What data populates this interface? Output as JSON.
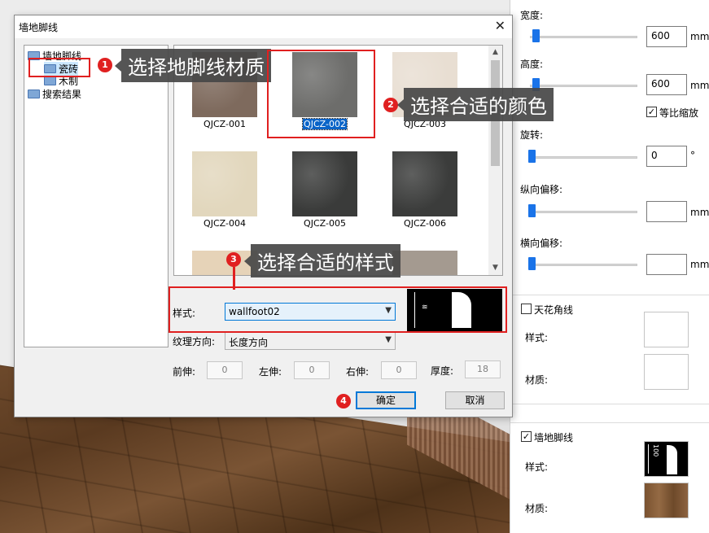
{
  "dialog": {
    "title": "墙地脚线",
    "close_glyph": "✕",
    "tree": {
      "root": "墙地脚线",
      "children": [
        "瓷砖",
        "木制"
      ],
      "search": "搜索结果"
    },
    "tiles": [
      {
        "label": "QJCZ-001",
        "color": "#7e6a5d",
        "selected": false
      },
      {
        "label": "QJCZ-002",
        "color": "#6d6d6b",
        "selected": true
      },
      {
        "label": "QJCZ-003",
        "color": "#e8ded2",
        "selected": false
      },
      {
        "label": "QJCZ-004",
        "color": "#e2d7bd",
        "selected": false
      },
      {
        "label": "QJCZ-005",
        "color": "#3a3b3a",
        "selected": false
      },
      {
        "label": "QJCZ-006",
        "color": "#3b3c3b",
        "selected": false
      }
    ],
    "style_label": "样式:",
    "style_value": "wallfoot02",
    "texture_label": "纹理方向:",
    "texture_value": "长度方向",
    "front_ext_label": "前伸:",
    "front_ext_value": "0",
    "left_ext_label": "左伸:",
    "left_ext_value": "0",
    "right_ext_label": "右伸:",
    "right_ext_value": "0",
    "thickness_label": "厚度:",
    "thickness_value": "18",
    "ok_label": "确定",
    "cancel_label": "取消"
  },
  "annotations": [
    {
      "badge": "1",
      "text": "选择地脚线材质"
    },
    {
      "badge": "2",
      "text": "选择合适的颜色"
    },
    {
      "badge": "3",
      "text": "选择合适的样式"
    },
    {
      "badge": "4",
      "text": ""
    }
  ],
  "panel": {
    "width_label": "宽度:",
    "width_value": "600",
    "width_unit": "mm",
    "height_label": "高度:",
    "height_value": "600",
    "height_unit": "mm",
    "keep_ratio_label": "等比缩放",
    "keep_ratio_checked": true,
    "rotate_label": "旋转:",
    "rotate_value": "0",
    "rotate_unit": "°",
    "v_offset_label": "纵向偏移:",
    "v_offset_value": "",
    "v_offset_unit": "mm",
    "h_offset_label": "横向偏移:",
    "h_offset_value": "",
    "h_offset_unit": "mm",
    "ceiling_line_label": "天花角线",
    "ceiling_line_checked": false,
    "ceiling_style_label": "样式:",
    "ceiling_material_label": "材质:",
    "wall_foot_label": "墙地脚线",
    "wall_foot_checked": true,
    "wall_foot_style_label": "样式:",
    "wall_foot_style_dim": "100",
    "wall_foot_material_label": "材质:",
    "wall_foot_material_color": "#8a5e3a"
  }
}
